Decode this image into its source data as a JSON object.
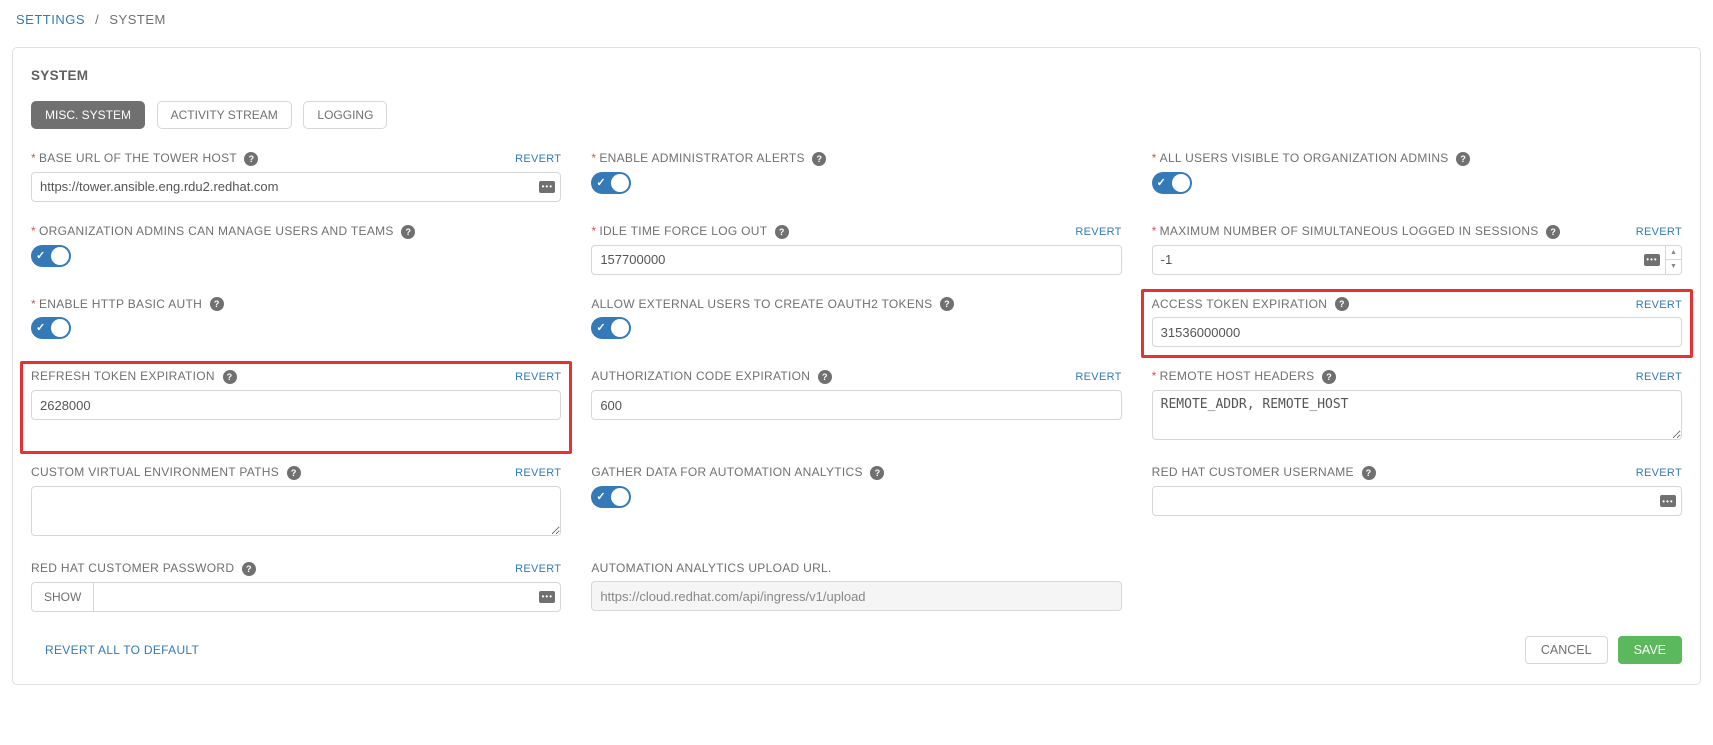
{
  "breadcrumb": {
    "root": "SETTINGS",
    "current": "SYSTEM"
  },
  "panel": {
    "title": "SYSTEM"
  },
  "tabs": [
    {
      "label": "MISC. SYSTEM",
      "active": true
    },
    {
      "label": "ACTIVITY STREAM",
      "active": false
    },
    {
      "label": "LOGGING",
      "active": false
    }
  ],
  "fields": {
    "base_url": {
      "label": "BASE URL OF THE TOWER HOST",
      "value": "https://tower.ansible.eng.rdu2.redhat.com",
      "revert": "REVERT"
    },
    "admin_alerts": {
      "label": "ENABLE ADMINISTRATOR ALERTS"
    },
    "all_users_visible": {
      "label": "ALL USERS VISIBLE TO ORGANIZATION ADMINS"
    },
    "org_admins_manage": {
      "label": "ORGANIZATION ADMINS CAN MANAGE USERS AND TEAMS"
    },
    "idle_time": {
      "label": "IDLE TIME FORCE LOG OUT",
      "value": "157700000",
      "revert": "REVERT"
    },
    "max_sessions": {
      "label": "MAXIMUM NUMBER OF SIMULTANEOUS LOGGED IN SESSIONS",
      "value": "-1",
      "revert": "REVERT"
    },
    "http_basic": {
      "label": "ENABLE HTTP BASIC AUTH"
    },
    "oauth_external": {
      "label": "ALLOW EXTERNAL USERS TO CREATE OAUTH2 TOKENS"
    },
    "access_token": {
      "label": "ACCESS TOKEN EXPIRATION",
      "value": "31536000000",
      "revert": "REVERT"
    },
    "refresh_token": {
      "label": "REFRESH TOKEN EXPIRATION",
      "value": "2628000",
      "revert": "REVERT"
    },
    "auth_code": {
      "label": "AUTHORIZATION CODE EXPIRATION",
      "value": "600",
      "revert": "REVERT"
    },
    "remote_headers": {
      "label": "REMOTE HOST HEADERS",
      "value": "REMOTE_ADDR, REMOTE_HOST",
      "revert": "REVERT"
    },
    "venv_paths": {
      "label": "CUSTOM VIRTUAL ENVIRONMENT PATHS",
      "value": "",
      "revert": "REVERT"
    },
    "gather_analytics": {
      "label": "GATHER DATA FOR AUTOMATION ANALYTICS"
    },
    "rh_username": {
      "label": "RED HAT CUSTOMER USERNAME",
      "value": "",
      "revert": "REVERT"
    },
    "rh_password": {
      "label": "RED HAT CUSTOMER PASSWORD",
      "show": "SHOW",
      "revert": "REVERT"
    },
    "upload_url": {
      "label": "AUTOMATION ANALYTICS UPLOAD URL.",
      "value": "https://cloud.redhat.com/api/ingress/v1/upload"
    }
  },
  "footer": {
    "revert_all": "REVERT ALL TO DEFAULT",
    "cancel": "CANCEL",
    "save": "SAVE"
  }
}
